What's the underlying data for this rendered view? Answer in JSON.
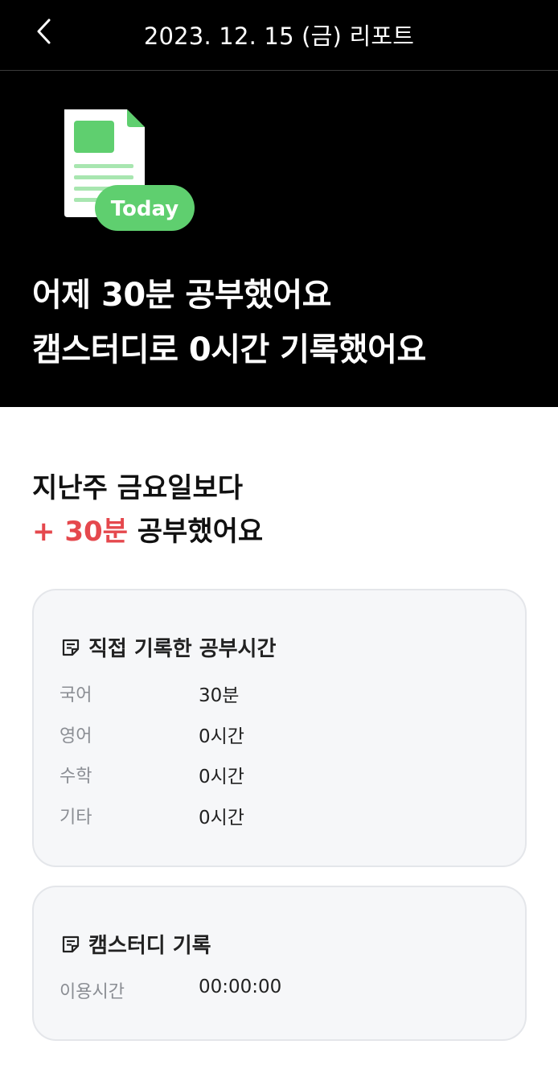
{
  "header": {
    "title": "2023. 12. 15 (금) 리포트",
    "back_icon": "chevron-left-icon"
  },
  "hero": {
    "badge": "Today",
    "line1": "어제 30분 공부했어요",
    "line2": "캠스터디로 0시간 기록했어요",
    "accent_color": "#5fcf6f"
  },
  "compare": {
    "line1": "지난주 금요일보다",
    "diff": "+ 30분",
    "suffix": " 공부했어요",
    "diff_color": "#e5484d"
  },
  "manual_card": {
    "title": "직접 기록한 공부시간",
    "icon": "note-icon",
    "rows": [
      {
        "label": "국어",
        "value": "30분"
      },
      {
        "label": "영어",
        "value": "0시간"
      },
      {
        "label": "수학",
        "value": "0시간"
      },
      {
        "label": "기타",
        "value": "0시간"
      }
    ]
  },
  "camstudy_card": {
    "title": "캠스터디 기록",
    "icon": "note-icon",
    "rows": [
      {
        "label": "이용시간",
        "value": "00:00:00"
      }
    ]
  }
}
